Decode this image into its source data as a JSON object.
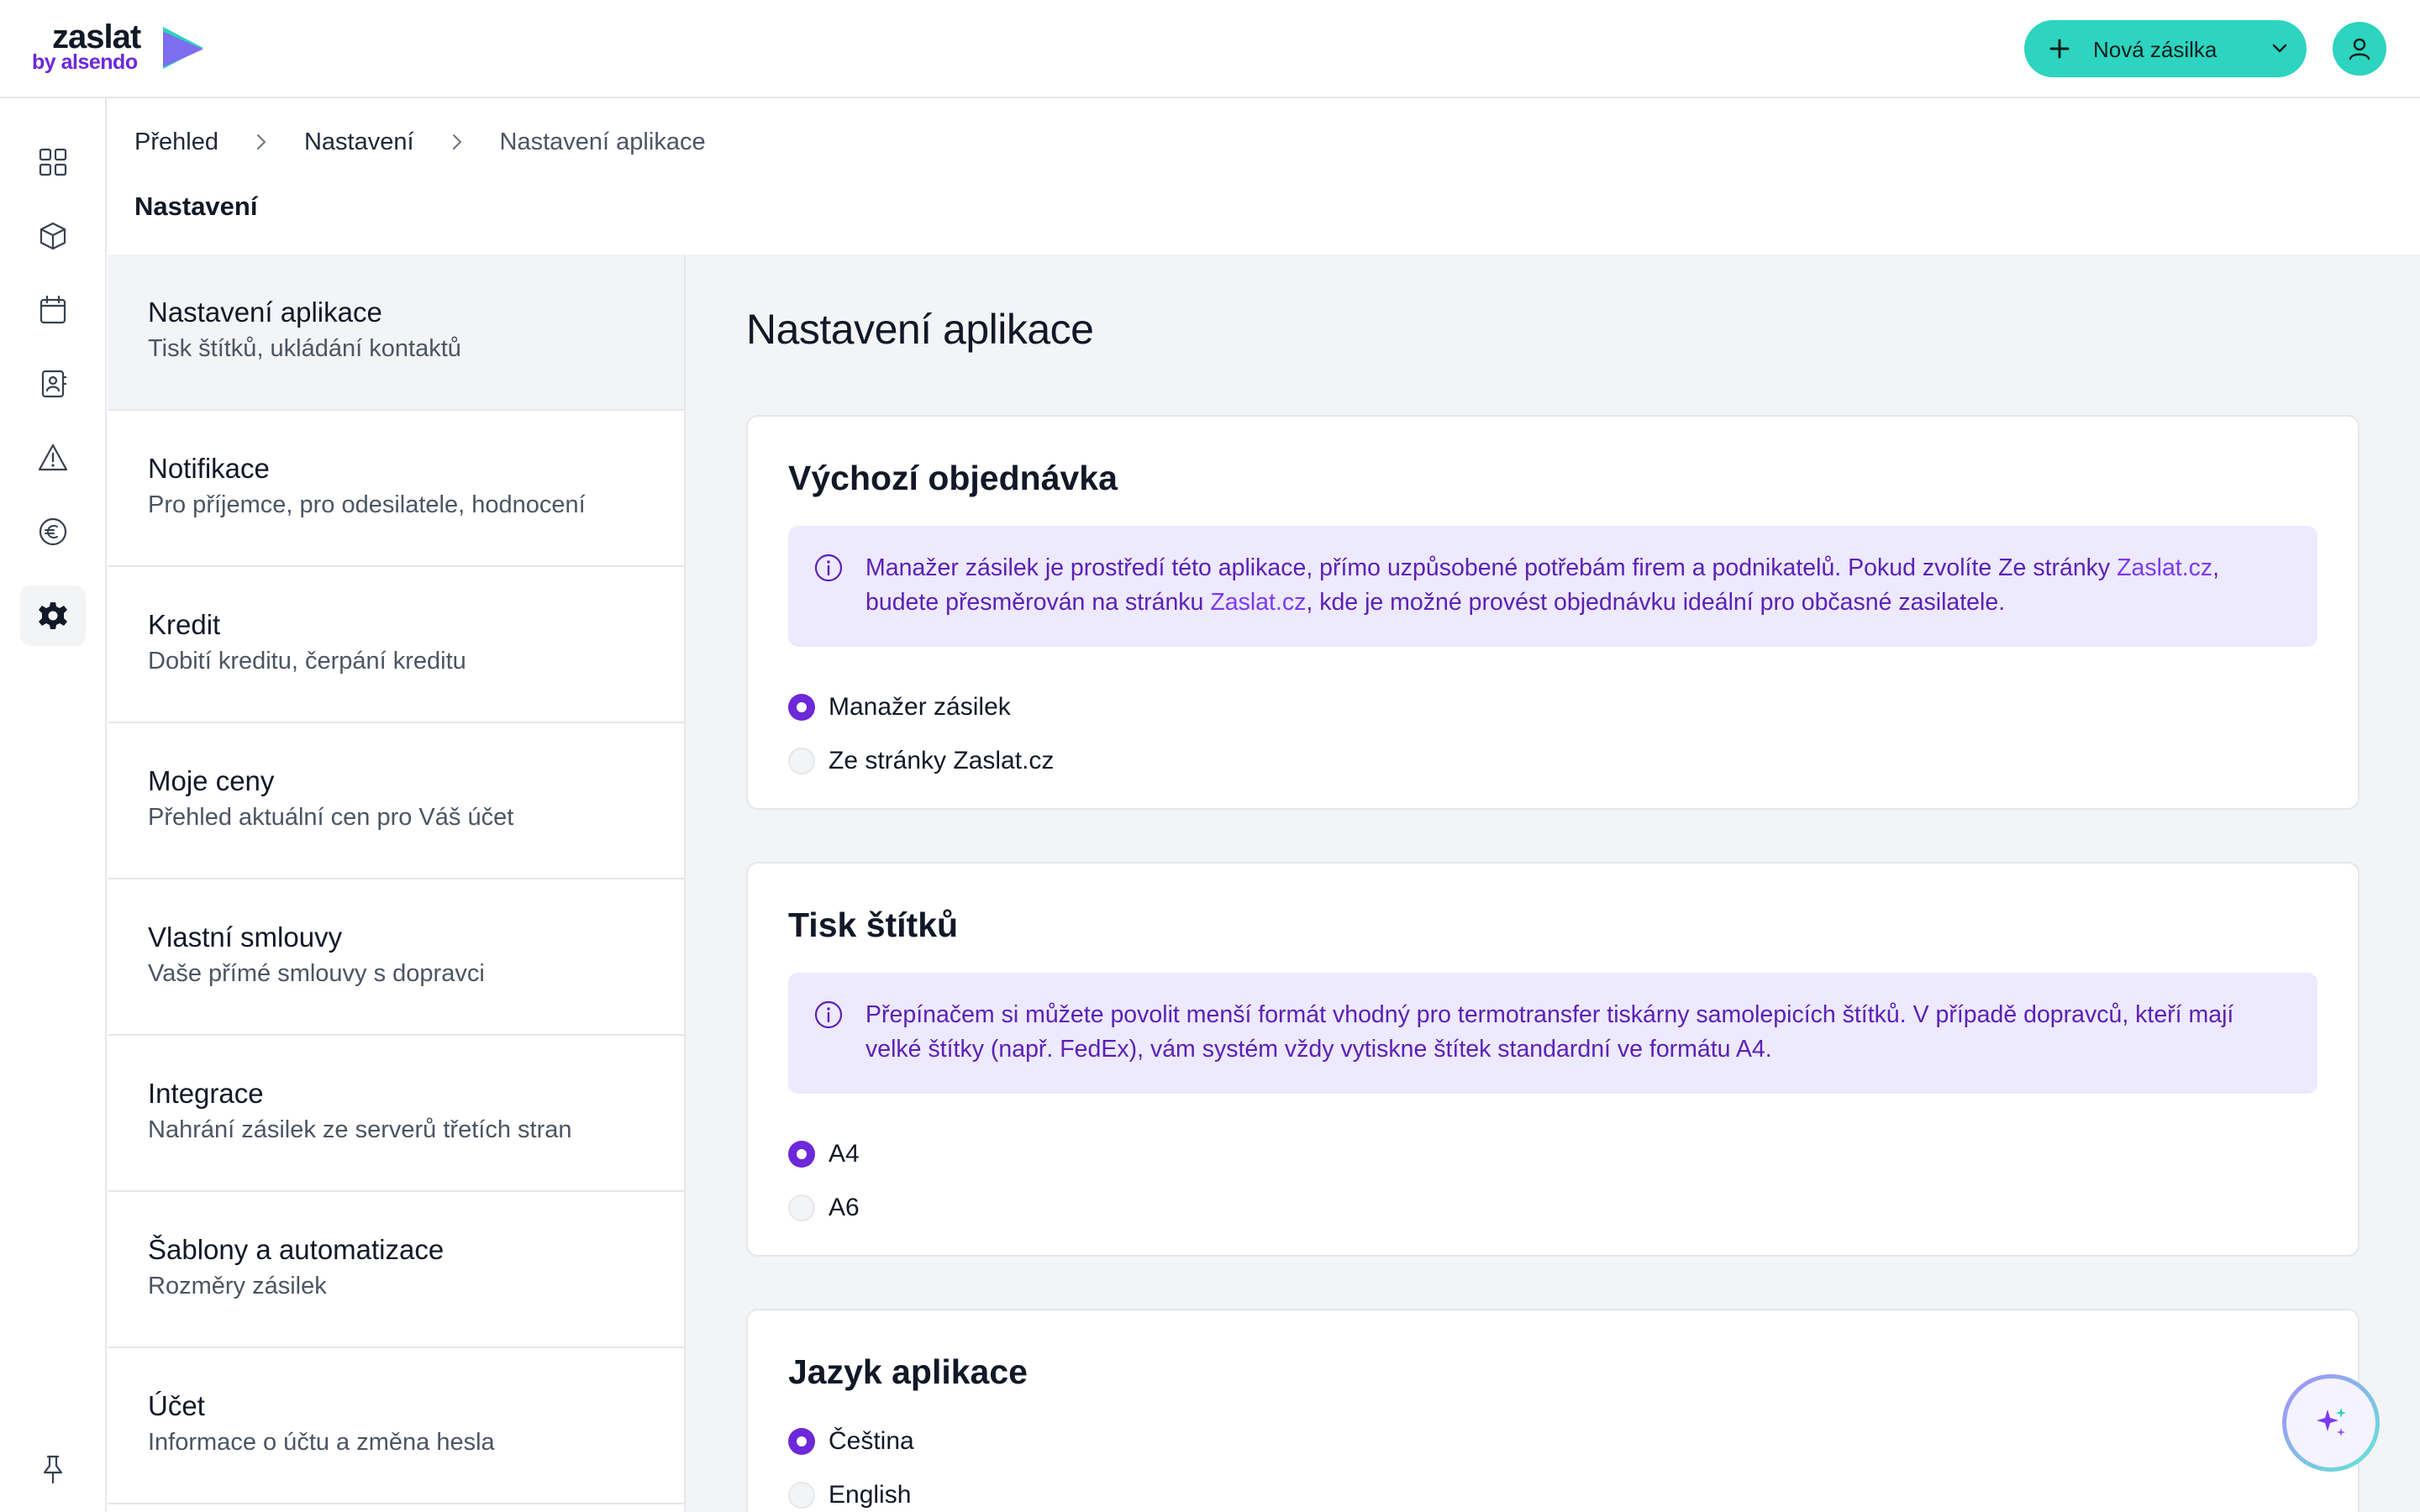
{
  "brand": {
    "name": "zaslat",
    "tagline": "by alsendo",
    "colors": {
      "accent": "#2dd4bf",
      "primary": "#6d28d9",
      "info_bg": "#ede9fe"
    }
  },
  "header": {
    "new_shipment_label": "Nová zásilka"
  },
  "rail": {
    "items": [
      {
        "icon": "grid-icon"
      },
      {
        "icon": "box-icon"
      },
      {
        "icon": "calendar-icon"
      },
      {
        "icon": "contacts-icon"
      },
      {
        "icon": "warning-icon"
      },
      {
        "icon": "euro-icon"
      },
      {
        "icon": "gear-icon",
        "active": true
      },
      {
        "icon": "pin-icon"
      }
    ]
  },
  "breadcrumb": [
    "Přehled",
    "Nastavení",
    "Nastavení aplikace"
  ],
  "page_title": "Nastavení",
  "settings_menu": [
    {
      "title": "Nastavení aplikace",
      "subtitle": "Tisk štítků, ukládání kontaktů"
    },
    {
      "title": "Notifikace",
      "subtitle": "Pro příjemce, pro odesilatele, hodnocení"
    },
    {
      "title": "Kredit",
      "subtitle": "Dobití kreditu, čerpání kreditu"
    },
    {
      "title": "Moje ceny",
      "subtitle": "Přehled aktuální cen pro Váš účet"
    },
    {
      "title": "Vlastní smlouvy",
      "subtitle": "Vaše přímé smlouvy s dopravci"
    },
    {
      "title": "Integrace",
      "subtitle": "Nahrání zásilek ze serverů třetích stran"
    },
    {
      "title": "Šablony a automatizace",
      "subtitle": "Rozměry zásilek"
    },
    {
      "title": "Účet",
      "subtitle": "Informace o účtu a změna hesla"
    }
  ],
  "main": {
    "title": "Nastavení aplikace",
    "default_order": {
      "title": "Výchozí objednávka",
      "info_part1": "Manažer zásilek je prostředí této aplikace, přímo uzpůsobené potřebám firem a podnikatelů. Pokud zvolíte Ze stránky ",
      "info_link1": "Zaslat.cz",
      "info_part2": ", budete přesměrován na stránku ",
      "info_link2": "Zaslat.cz",
      "info_part3": ", kde je možné provést objednávku ideální pro občasné zasilatele.",
      "options": [
        "Manažer zásilek",
        "Ze stránky Zaslat.cz"
      ],
      "selected": "Manažer zásilek"
    },
    "label_print": {
      "title": "Tisk štítků",
      "info": "Přepínačem si můžete povolit menší formát vhodný pro termotransfer tiskárny samolepicích štítků. V případě dopravců, kteří mají velké štítky (např. FedEx), vám systém vždy vytiskne štítek standardní ve formátu A4.",
      "options": [
        "A4",
        "A6"
      ],
      "selected": "A4"
    },
    "language": {
      "title": "Jazyk aplikace",
      "options": [
        "Čeština",
        "English"
      ],
      "selected": "Čeština"
    }
  }
}
